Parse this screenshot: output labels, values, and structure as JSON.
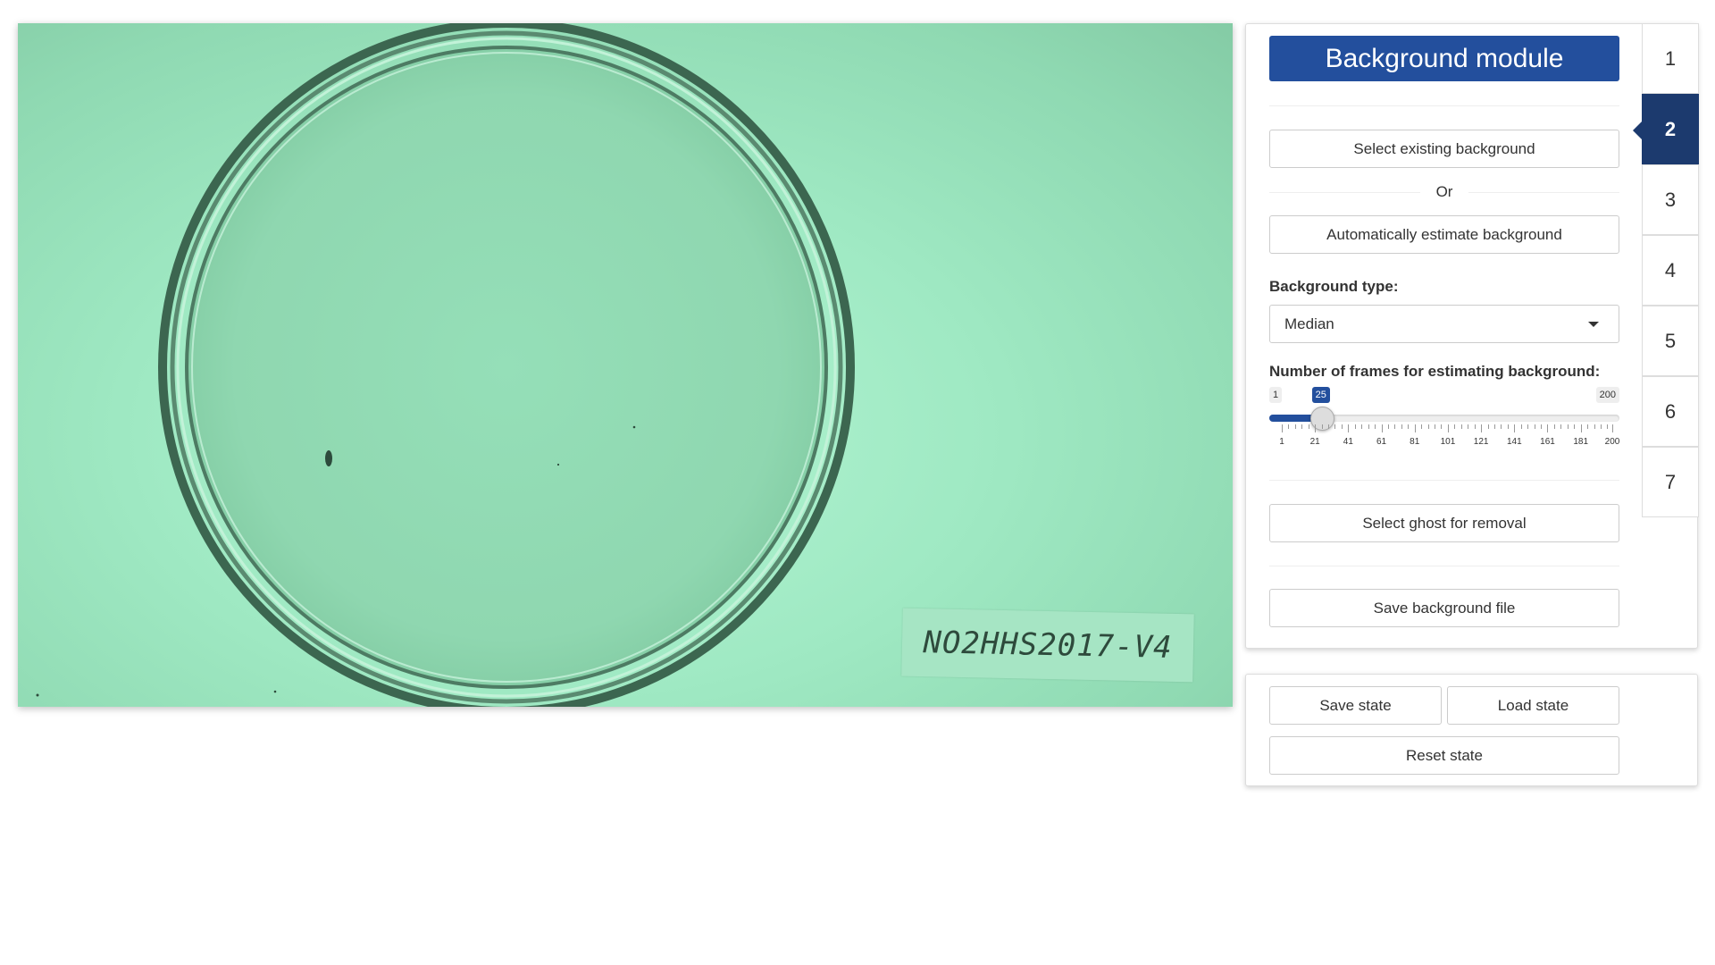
{
  "display": {
    "plate_label": "NO2HHS2017-V4",
    "tint_color": "#9fe9c3"
  },
  "panel": {
    "title": "Background module",
    "select_existing": "Select existing background",
    "or_text": "Or",
    "auto_estimate": "Automatically estimate background",
    "background_type_label": "Background type:",
    "background_type_value": "Median",
    "frames_label": "Number of frames for estimating background:",
    "frames_slider": {
      "min": 1,
      "max": 200,
      "value": 25,
      "min_label": "1",
      "max_label": "200",
      "value_label": "25",
      "tick_labels": [
        "1",
        "21",
        "41",
        "61",
        "81",
        "101",
        "121",
        "141",
        "161",
        "181",
        "200"
      ]
    },
    "select_ghost": "Select ghost for removal",
    "save_background": "Save background file"
  },
  "tabs": [
    {
      "label": "1",
      "active": false
    },
    {
      "label": "2",
      "active": true
    },
    {
      "label": "3",
      "active": false
    },
    {
      "label": "4",
      "active": false
    },
    {
      "label": "5",
      "active": false
    },
    {
      "label": "6",
      "active": false
    },
    {
      "label": "7",
      "active": false
    }
  ],
  "state": {
    "save": "Save state",
    "load": "Load state",
    "reset": "Reset state"
  },
  "colors": {
    "accent": "#234f9d",
    "active_tab": "#1c3a6e"
  }
}
